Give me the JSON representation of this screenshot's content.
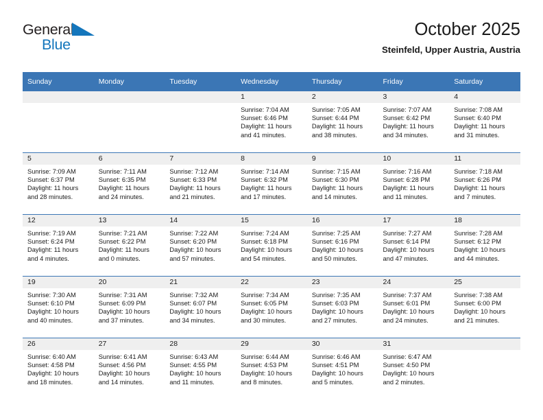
{
  "brand": {
    "name_part1": "General",
    "name_part2": "Blue",
    "triangle_icon": "blue-triangle-icon",
    "color_dark": "#231f20",
    "color_blue": "#1476bc"
  },
  "header": {
    "title": "October 2025",
    "subtitle": "Steinfeld, Upper Austria, Austria"
  },
  "theme": {
    "header_blue": "#3b76b5",
    "day_strip_grey": "#efefef",
    "text": "#1a1a1a"
  },
  "calendar": {
    "weekday_headers": [
      "Sunday",
      "Monday",
      "Tuesday",
      "Wednesday",
      "Thursday",
      "Friday",
      "Saturday"
    ],
    "weeks": [
      [
        {
          "day": "",
          "sunrise": "",
          "sunset": "",
          "daylight_line1": "",
          "daylight_line2": ""
        },
        {
          "day": "",
          "sunrise": "",
          "sunset": "",
          "daylight_line1": "",
          "daylight_line2": ""
        },
        {
          "day": "",
          "sunrise": "",
          "sunset": "",
          "daylight_line1": "",
          "daylight_line2": ""
        },
        {
          "day": "1",
          "sunrise": "Sunrise: 7:04 AM",
          "sunset": "Sunset: 6:46 PM",
          "daylight_line1": "Daylight: 11 hours",
          "daylight_line2": "and 41 minutes."
        },
        {
          "day": "2",
          "sunrise": "Sunrise: 7:05 AM",
          "sunset": "Sunset: 6:44 PM",
          "daylight_line1": "Daylight: 11 hours",
          "daylight_line2": "and 38 minutes."
        },
        {
          "day": "3",
          "sunrise": "Sunrise: 7:07 AM",
          "sunset": "Sunset: 6:42 PM",
          "daylight_line1": "Daylight: 11 hours",
          "daylight_line2": "and 34 minutes."
        },
        {
          "day": "4",
          "sunrise": "Sunrise: 7:08 AM",
          "sunset": "Sunset: 6:40 PM",
          "daylight_line1": "Daylight: 11 hours",
          "daylight_line2": "and 31 minutes."
        }
      ],
      [
        {
          "day": "5",
          "sunrise": "Sunrise: 7:09 AM",
          "sunset": "Sunset: 6:37 PM",
          "daylight_line1": "Daylight: 11 hours",
          "daylight_line2": "and 28 minutes."
        },
        {
          "day": "6",
          "sunrise": "Sunrise: 7:11 AM",
          "sunset": "Sunset: 6:35 PM",
          "daylight_line1": "Daylight: 11 hours",
          "daylight_line2": "and 24 minutes."
        },
        {
          "day": "7",
          "sunrise": "Sunrise: 7:12 AM",
          "sunset": "Sunset: 6:33 PM",
          "daylight_line1": "Daylight: 11 hours",
          "daylight_line2": "and 21 minutes."
        },
        {
          "day": "8",
          "sunrise": "Sunrise: 7:14 AM",
          "sunset": "Sunset: 6:32 PM",
          "daylight_line1": "Daylight: 11 hours",
          "daylight_line2": "and 17 minutes."
        },
        {
          "day": "9",
          "sunrise": "Sunrise: 7:15 AM",
          "sunset": "Sunset: 6:30 PM",
          "daylight_line1": "Daylight: 11 hours",
          "daylight_line2": "and 14 minutes."
        },
        {
          "day": "10",
          "sunrise": "Sunrise: 7:16 AM",
          "sunset": "Sunset: 6:28 PM",
          "daylight_line1": "Daylight: 11 hours",
          "daylight_line2": "and 11 minutes."
        },
        {
          "day": "11",
          "sunrise": "Sunrise: 7:18 AM",
          "sunset": "Sunset: 6:26 PM",
          "daylight_line1": "Daylight: 11 hours",
          "daylight_line2": "and 7 minutes."
        }
      ],
      [
        {
          "day": "12",
          "sunrise": "Sunrise: 7:19 AM",
          "sunset": "Sunset: 6:24 PM",
          "daylight_line1": "Daylight: 11 hours",
          "daylight_line2": "and 4 minutes."
        },
        {
          "day": "13",
          "sunrise": "Sunrise: 7:21 AM",
          "sunset": "Sunset: 6:22 PM",
          "daylight_line1": "Daylight: 11 hours",
          "daylight_line2": "and 0 minutes."
        },
        {
          "day": "14",
          "sunrise": "Sunrise: 7:22 AM",
          "sunset": "Sunset: 6:20 PM",
          "daylight_line1": "Daylight: 10 hours",
          "daylight_line2": "and 57 minutes."
        },
        {
          "day": "15",
          "sunrise": "Sunrise: 7:24 AM",
          "sunset": "Sunset: 6:18 PM",
          "daylight_line1": "Daylight: 10 hours",
          "daylight_line2": "and 54 minutes."
        },
        {
          "day": "16",
          "sunrise": "Sunrise: 7:25 AM",
          "sunset": "Sunset: 6:16 PM",
          "daylight_line1": "Daylight: 10 hours",
          "daylight_line2": "and 50 minutes."
        },
        {
          "day": "17",
          "sunrise": "Sunrise: 7:27 AM",
          "sunset": "Sunset: 6:14 PM",
          "daylight_line1": "Daylight: 10 hours",
          "daylight_line2": "and 47 minutes."
        },
        {
          "day": "18",
          "sunrise": "Sunrise: 7:28 AM",
          "sunset": "Sunset: 6:12 PM",
          "daylight_line1": "Daylight: 10 hours",
          "daylight_line2": "and 44 minutes."
        }
      ],
      [
        {
          "day": "19",
          "sunrise": "Sunrise: 7:30 AM",
          "sunset": "Sunset: 6:10 PM",
          "daylight_line1": "Daylight: 10 hours",
          "daylight_line2": "and 40 minutes."
        },
        {
          "day": "20",
          "sunrise": "Sunrise: 7:31 AM",
          "sunset": "Sunset: 6:09 PM",
          "daylight_line1": "Daylight: 10 hours",
          "daylight_line2": "and 37 minutes."
        },
        {
          "day": "21",
          "sunrise": "Sunrise: 7:32 AM",
          "sunset": "Sunset: 6:07 PM",
          "daylight_line1": "Daylight: 10 hours",
          "daylight_line2": "and 34 minutes."
        },
        {
          "day": "22",
          "sunrise": "Sunrise: 7:34 AM",
          "sunset": "Sunset: 6:05 PM",
          "daylight_line1": "Daylight: 10 hours",
          "daylight_line2": "and 30 minutes."
        },
        {
          "day": "23",
          "sunrise": "Sunrise: 7:35 AM",
          "sunset": "Sunset: 6:03 PM",
          "daylight_line1": "Daylight: 10 hours",
          "daylight_line2": "and 27 minutes."
        },
        {
          "day": "24",
          "sunrise": "Sunrise: 7:37 AM",
          "sunset": "Sunset: 6:01 PM",
          "daylight_line1": "Daylight: 10 hours",
          "daylight_line2": "and 24 minutes."
        },
        {
          "day": "25",
          "sunrise": "Sunrise: 7:38 AM",
          "sunset": "Sunset: 6:00 PM",
          "daylight_line1": "Daylight: 10 hours",
          "daylight_line2": "and 21 minutes."
        }
      ],
      [
        {
          "day": "26",
          "sunrise": "Sunrise: 6:40 AM",
          "sunset": "Sunset: 4:58 PM",
          "daylight_line1": "Daylight: 10 hours",
          "daylight_line2": "and 18 minutes."
        },
        {
          "day": "27",
          "sunrise": "Sunrise: 6:41 AM",
          "sunset": "Sunset: 4:56 PM",
          "daylight_line1": "Daylight: 10 hours",
          "daylight_line2": "and 14 minutes."
        },
        {
          "day": "28",
          "sunrise": "Sunrise: 6:43 AM",
          "sunset": "Sunset: 4:55 PM",
          "daylight_line1": "Daylight: 10 hours",
          "daylight_line2": "and 11 minutes."
        },
        {
          "day": "29",
          "sunrise": "Sunrise: 6:44 AM",
          "sunset": "Sunset: 4:53 PM",
          "daylight_line1": "Daylight: 10 hours",
          "daylight_line2": "and 8 minutes."
        },
        {
          "day": "30",
          "sunrise": "Sunrise: 6:46 AM",
          "sunset": "Sunset: 4:51 PM",
          "daylight_line1": "Daylight: 10 hours",
          "daylight_line2": "and 5 minutes."
        },
        {
          "day": "31",
          "sunrise": "Sunrise: 6:47 AM",
          "sunset": "Sunset: 4:50 PM",
          "daylight_line1": "Daylight: 10 hours",
          "daylight_line2": "and 2 minutes."
        },
        {
          "day": "",
          "sunrise": "",
          "sunset": "",
          "daylight_line1": "",
          "daylight_line2": ""
        }
      ]
    ]
  }
}
